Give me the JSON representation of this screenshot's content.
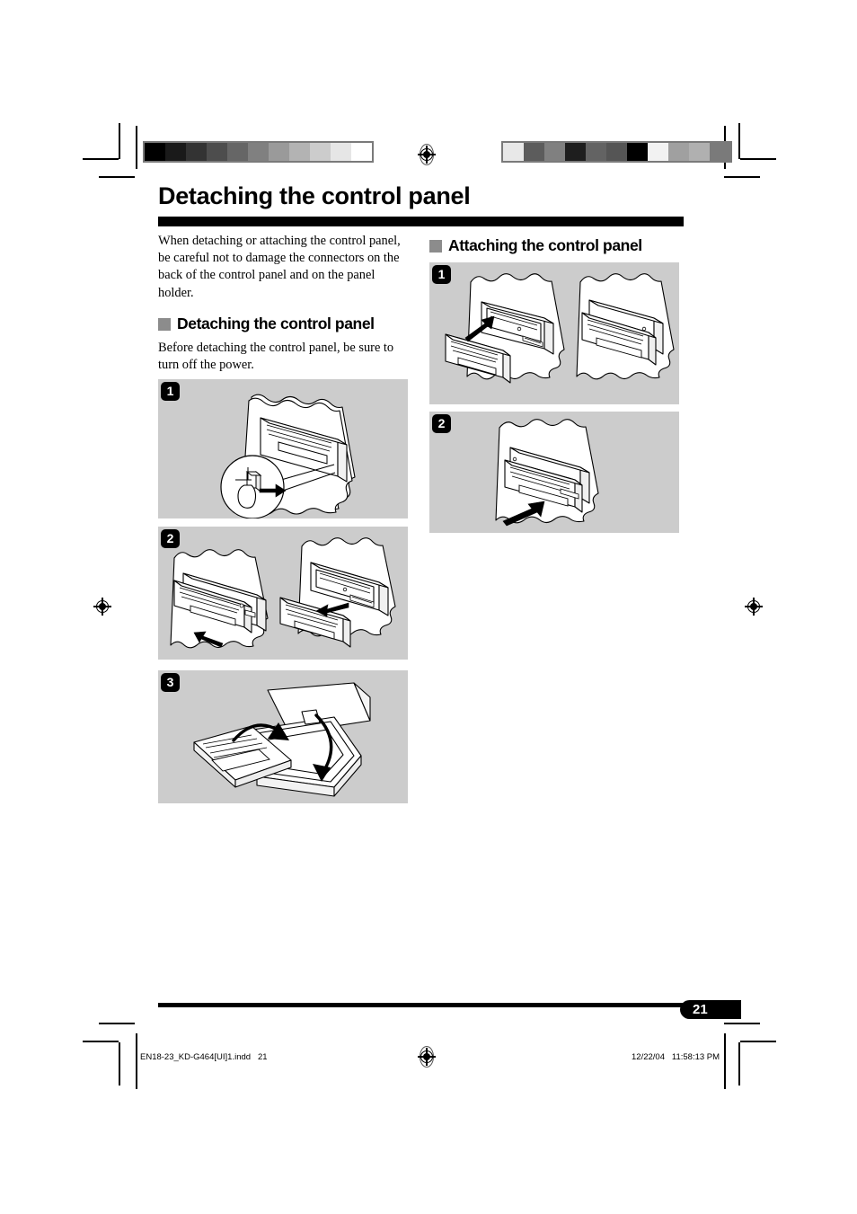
{
  "document": {
    "page_title": "Detaching the control panel",
    "page_number": "21"
  },
  "intro": {
    "text": "When detaching or attaching the control panel, be careful not to damage the connectors on the back of the control panel and on the panel holder."
  },
  "left_column": {
    "section_heading": "Detaching the control panel",
    "section_bullet": "gray-square-bullet",
    "note": "Before detaching the control panel, be sure to turn off the power.",
    "figures": [
      {
        "step": "1",
        "caption": "car-stereo-front-panel-release-button-detail",
        "icons": [
          "panel-release-button-icon",
          "finger-press-icon",
          "magnifier-circle-icon",
          "arrow-right-icon"
        ]
      },
      {
        "step": "2",
        "caption": "control-panel-pulled-off-from-holder",
        "icons": [
          "arrow-left-icon",
          "arrow-left-icon"
        ]
      },
      {
        "step": "3",
        "caption": "control-panel-placed-into-carrying-case",
        "icons": [
          "rotate-arrow-icon",
          "rotate-arrow-icon"
        ]
      }
    ]
  },
  "right_column": {
    "section_heading": "Attaching the control panel",
    "section_bullet": "gray-square-bullet",
    "figures": [
      {
        "step": "1",
        "caption": "control-panel-aligned-with-holder-left-side-first",
        "icons": [
          "arrow-up-left-icon"
        ]
      },
      {
        "step": "2",
        "caption": "control-panel-pressed-until-it-locks",
        "icons": [
          "arrow-up-right-icon"
        ]
      }
    ]
  },
  "footer": {
    "file_name": "EN18-23_KD-G464[UI]1.indd   21",
    "timestamp": "12/22/04   11:58:13 PM"
  },
  "print_marks": {
    "left_calibration_swatches": [
      "#000000",
      "#1a1a1a",
      "#333333",
      "#4d4d4d",
      "#666666",
      "#808080",
      "#9a9a9a",
      "#b3b3b3",
      "#cccccc",
      "#e6e6e6",
      "#ffffff"
    ],
    "right_calibration_swatches": [
      "#e8e8e8",
      "#5c5c5c",
      "#808080",
      "#1e1e1e",
      "#636363",
      "#555555",
      "#000000",
      "#f2f2f2",
      "#a0a0a0",
      "#b0b0b0",
      "#7a7a7a"
    ],
    "registration_mark": "registration-crosshair-icon",
    "colors": {
      "figure_background": "#cccccc",
      "bullet_gray": "#8c8c8c",
      "rule_black": "#000000"
    }
  }
}
